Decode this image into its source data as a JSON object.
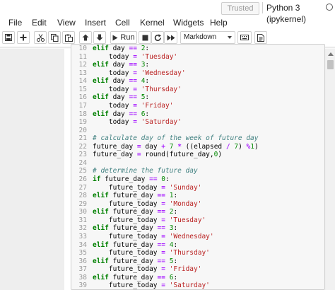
{
  "header": {
    "trusted_label": "Trusted",
    "kernel_name": "Python 3 (ipykernel)"
  },
  "menu": [
    "File",
    "Edit",
    "View",
    "Insert",
    "Cell",
    "Kernel",
    "Widgets",
    "Help"
  ],
  "toolbar": {
    "run_label": "Run",
    "cell_type": "Markdown",
    "buttons": [
      "save-icon",
      "add-icon",
      "cut-icon",
      "copy-icon",
      "paste-icon",
      "move-up-icon",
      "move-down-icon",
      "run-icon",
      "stop-icon",
      "restart-icon",
      "fast-forward-icon",
      "keyboard-icon",
      "command-palette-icon"
    ]
  },
  "code_lines": [
    {
      "n": "10",
      "text": "elif day == 2:"
    },
    {
      "n": "11",
      "text": "    today = 'Tuesday'"
    },
    {
      "n": "12",
      "text": "elif day == 3:"
    },
    {
      "n": "13",
      "text": "    today = 'Wednesday'"
    },
    {
      "n": "14",
      "text": "elif day == 4:"
    },
    {
      "n": "15",
      "text": "    today = 'Thursday'"
    },
    {
      "n": "16",
      "text": "elif day == 5:"
    },
    {
      "n": "17",
      "text": "    today = 'Friday'"
    },
    {
      "n": "18",
      "text": "elif day == 6:"
    },
    {
      "n": "19",
      "text": "    today = 'Saturday'"
    },
    {
      "n": "20",
      "text": ""
    },
    {
      "n": "21",
      "text": "# calculate day of the week of future day"
    },
    {
      "n": "22",
      "text": "future_day = day + 7 * ((elapsed / 7) %1)"
    },
    {
      "n": "23",
      "text": "future_day = round(future_day,0)"
    },
    {
      "n": "24",
      "text": ""
    },
    {
      "n": "25",
      "text": "# determine the future day"
    },
    {
      "n": "26",
      "text": "if future_day == 0:"
    },
    {
      "n": "27",
      "text": "    future_today = 'Sunday'"
    },
    {
      "n": "28",
      "text": "elif future_day == 1:"
    },
    {
      "n": "29",
      "text": "    future_today = 'Monday'"
    },
    {
      "n": "30",
      "text": "elif future_day == 2:"
    },
    {
      "n": "31",
      "text": "    future_today = 'Tuesday'"
    },
    {
      "n": "32",
      "text": "elif future_day == 3:"
    },
    {
      "n": "33",
      "text": "    future_today = 'Wednesday'"
    },
    {
      "n": "34",
      "text": "elif future_day == 4:"
    },
    {
      "n": "35",
      "text": "    future_today = 'Thursday'"
    },
    {
      "n": "36",
      "text": "elif future_day == 5:"
    },
    {
      "n": "37",
      "text": "    future_today = 'Friday'"
    },
    {
      "n": "38",
      "text": "elif future_day == 6:"
    },
    {
      "n": "39",
      "text": "    future_today = 'Saturday'"
    }
  ],
  "colors": {
    "keyword": "#008000",
    "string": "#ba2121",
    "comment": "#408080",
    "operator": "#aa22ff",
    "cell_background": "#f7f7f7",
    "notebook_background": "#eeeeee"
  }
}
